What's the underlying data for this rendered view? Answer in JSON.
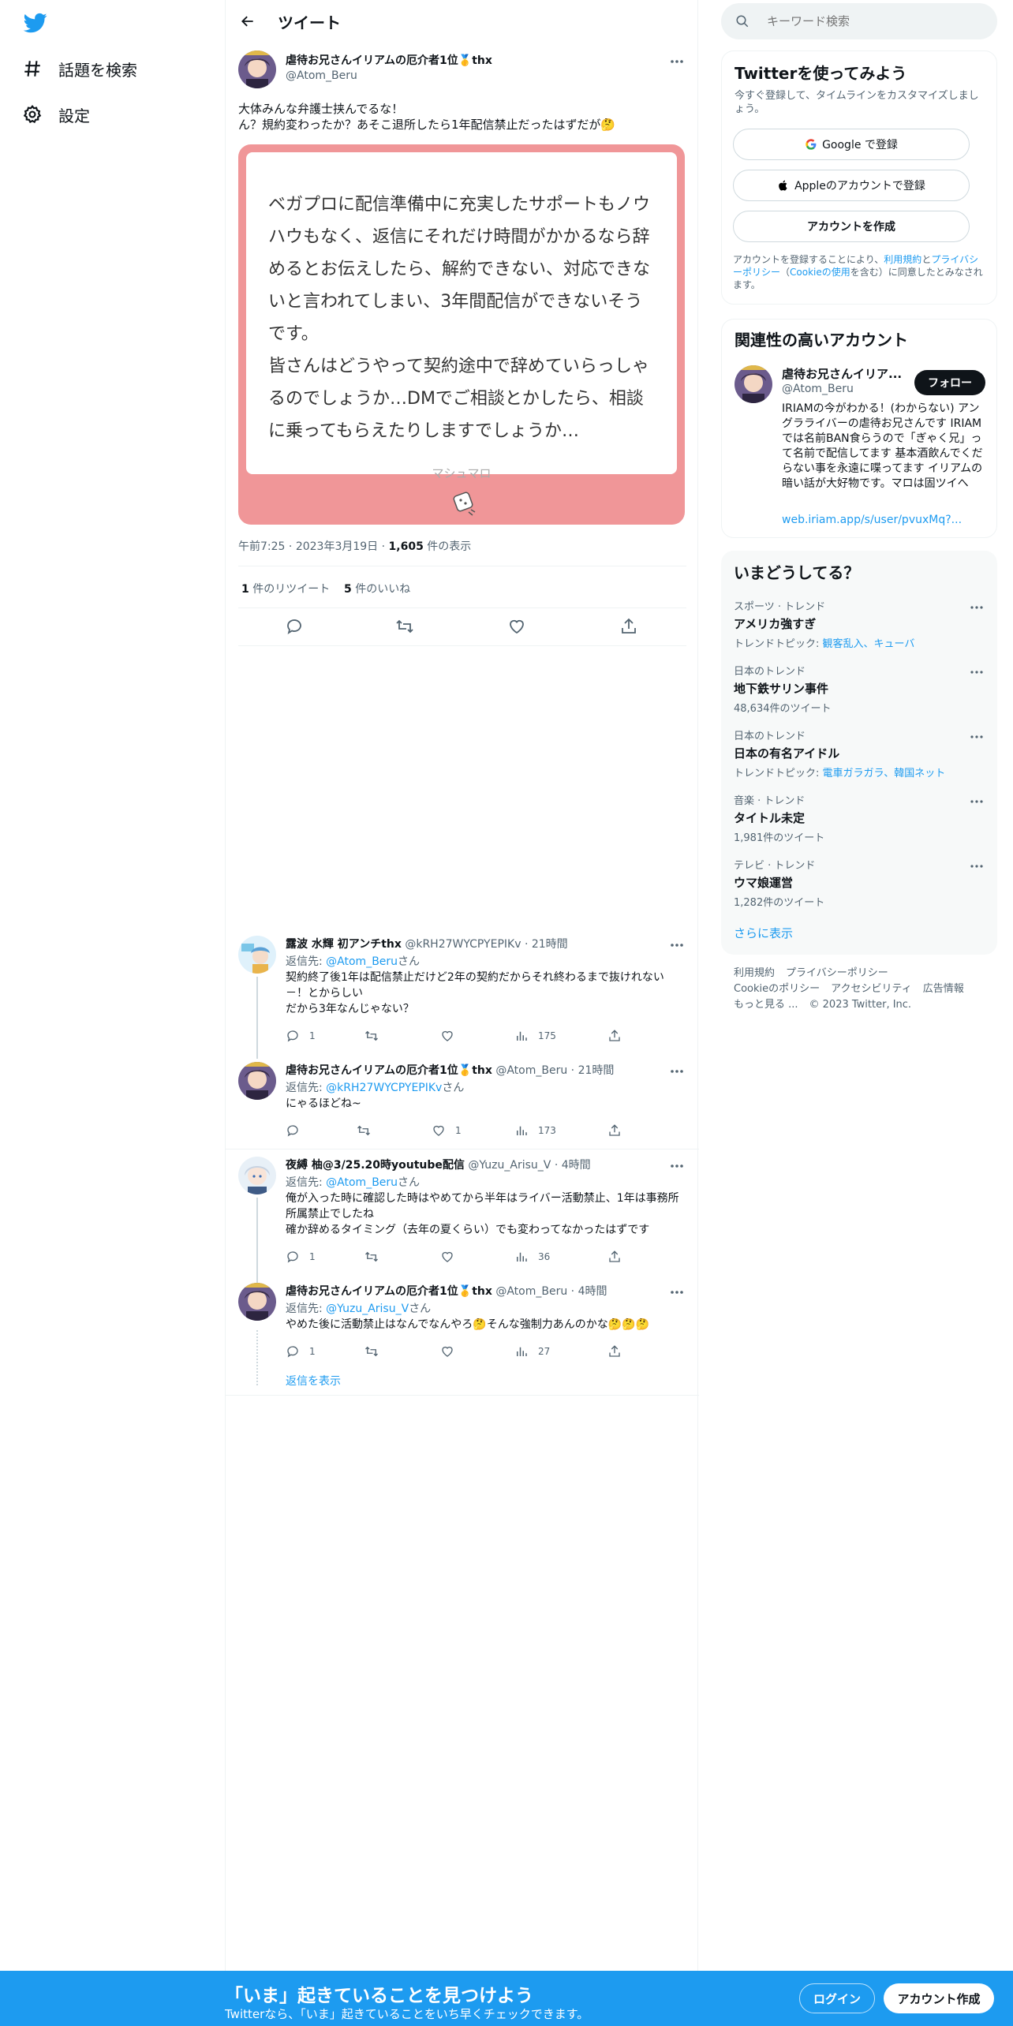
{
  "nav": {
    "explore_label": "話題を検索",
    "settings_label": "設定"
  },
  "header": {
    "title": "ツイート"
  },
  "tweet": {
    "name": "虐待お兄さんイリアムの厄介者1位🥇thx",
    "handle": "@Atom_Beru",
    "text_line1": "大体みんな弁護士挟んでるな！",
    "text_line2": "ん？規約変わったか？あそこ退所したら1年配信禁止だったはずだが🤔",
    "card_text_p1": "ベガプロに配信準備中に充実したサポートもノウハウもなく、返信にそれだけ時間がかかるなら辞めるとお伝えしたら、解約できない、対応できないと言われてしまい、3年間配信ができないそうです。",
    "card_text_p2": "皆さんはどうやって契約途中で辞めていらっしゃるのでしょうか…DMでご相談とかしたら、相談に乗ってもらえたりしますでしょうか…",
    "card_footer": "マシュマロ",
    "time": "午前7:25",
    "date": "2023年3月19日",
    "views_count": "1,605",
    "views_label": "件の表示",
    "retweets_count": "1",
    "retweets_label": "件のリツイート",
    "likes_count": "5",
    "likes_label": "件のいいね"
  },
  "replies": [
    {
      "name": "露波 水輝 初アンチthx",
      "handle": "@kRH27WYCPYEPIKv",
      "time": "21時間",
      "reply_prefix": "返信先:",
      "reply_to": "@Atom_Beru",
      "reply_suffix": "さん",
      "body": "契約終了後1年は配信禁止だけど2年の契約だからそれ終わるまで抜けれない－！とからしい\nだから3年なんじゃない？",
      "reply_count": "1",
      "retweet_count": "",
      "like_count": "",
      "view_count": "175"
    },
    {
      "name": "虐待お兄さんイリアムの厄介者1位🥇thx",
      "handle": "@Atom_Beru",
      "time": "21時間",
      "reply_prefix": "返信先:",
      "reply_to": "@kRH27WYCPYEPIKv",
      "reply_suffix": "さん",
      "body": "にゃるほどね~",
      "reply_count": "",
      "retweet_count": "",
      "like_count": "1",
      "view_count": "173"
    },
    {
      "name": "夜縛 柚@3/25.20時youtube配信",
      "handle": "@Yuzu_Arisu_V",
      "time": "4時間",
      "reply_prefix": "返信先:",
      "reply_to": "@Atom_Beru",
      "reply_suffix": "さん",
      "body": "俺が入った時に確認した時はやめてから半年はライバー活動禁止、1年は事務所所属禁止でしたね\n確か辞めるタイミング（去年の夏くらい）でも変わってなかったはずです",
      "reply_count": "1",
      "retweet_count": "",
      "like_count": "",
      "view_count": "36"
    },
    {
      "name": "虐待お兄さんイリアムの厄介者1位🥇thx",
      "handle": "@Atom_Beru",
      "time": "4時間",
      "reply_prefix": "返信先:",
      "reply_to": "@Yuzu_Arisu_V",
      "reply_suffix": "さん",
      "body": "やめた後に活動禁止はなんでなんやろ🤔そんな強制力あんのかな🤔🤔🤔",
      "reply_count": "1",
      "retweet_count": "",
      "like_count": "",
      "view_count": "27"
    }
  ],
  "show_replies": "返信を表示",
  "search": {
    "placeholder": "キーワード検索"
  },
  "signup_panel": {
    "title": "Twitterを使ってみよう",
    "subtitle": "今すぐ登録して、タイムラインをカスタマイズしましょう。",
    "google_btn": "Google で登録",
    "apple_btn": "Appleのアカウントで登録",
    "create_btn": "アカウントを作成",
    "terms_pre": "アカウントを登録することにより、",
    "terms_link1": "利用規約",
    "terms_and": "と",
    "terms_link2": "プライバシーポリシー",
    "terms_paren_open": "（",
    "terms_link3": "Cookieの使用",
    "terms_post": "を含む）に同意したとみなされます。"
  },
  "related_panel": {
    "title": "関連性の高いアカウント",
    "name": "虐待お兄さんイリア...",
    "handle": "@Atom_Beru",
    "follow_btn": "フォロー",
    "bio": "IRIAMの今がわかる！(わからない) アングラライバーの虐待お兄さんです IRIAMでは名前BAN食らうので「ぎゃく兄」って名前で配信してます 基本酒飲んでくだらない事を永遠に喋ってます イリアムの暗い話が大好物です。マロは固ツイへ",
    "link": "web.iriam.app/s/user/pvuxMq?..."
  },
  "trends_panel": {
    "title": "いまどうしてる？",
    "items": [
      {
        "category": "スポーツ · トレンド",
        "name": "アメリカ強すぎ",
        "sub_prefix": "トレンドトピック: ",
        "sub_links": "観客乱入、キューバ"
      },
      {
        "category": "日本のトレンド",
        "name": "地下鉄サリン事件",
        "sub_prefix": "48,634件のツイート",
        "sub_links": ""
      },
      {
        "category": "日本のトレンド",
        "name": "日本の有名アイドル",
        "sub_prefix": "トレンドトピック: ",
        "sub_links": "電車ガラガラ、韓国ネット"
      },
      {
        "category": "音楽 · トレンド",
        "name": "タイトル未定",
        "sub_prefix": "1,981件のツイート",
        "sub_links": ""
      },
      {
        "category": "テレビ · トレンド",
        "name": "ウマ娘運営",
        "sub_prefix": "1,282件のツイート",
        "sub_links": ""
      }
    ],
    "show_more": "さらに表示"
  },
  "footer": {
    "terms": "利用規約",
    "privacy": "プライバシーポリシー",
    "cookie": "Cookieのポリシー",
    "accessibility": "アクセシビリティ",
    "ads": "広告情報",
    "more": "もっと見る ...",
    "copyright": "© 2023 Twitter, Inc."
  },
  "bottom_bar": {
    "title": "「いま」起きていることを見つけよう",
    "subtitle": "Twitterなら、「いま」起きていることをいち早くチェックできます。",
    "login": "ログイン",
    "signup": "アカウント作成"
  },
  "colors": {
    "accent": "#1d9bf0",
    "card_border": "#f09698",
    "text": "#0f1419",
    "muted": "#536471"
  }
}
